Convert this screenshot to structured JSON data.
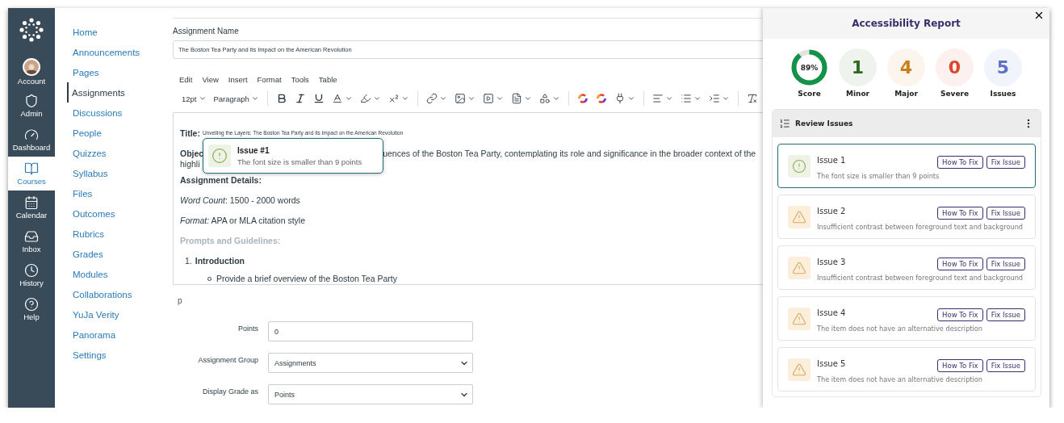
{
  "global_nav": [
    {
      "label": "Account",
      "selected": false
    },
    {
      "label": "Admin",
      "selected": false
    },
    {
      "label": "Dashboard",
      "selected": false
    },
    {
      "label": "Courses",
      "selected": true
    },
    {
      "label": "Calendar",
      "selected": false
    },
    {
      "label": "Inbox",
      "selected": false
    },
    {
      "label": "History",
      "selected": false
    },
    {
      "label": "Help",
      "selected": false
    }
  ],
  "course_nav": [
    {
      "label": "Home",
      "selected": false
    },
    {
      "label": "Announcements",
      "selected": false
    },
    {
      "label": "Pages",
      "selected": false
    },
    {
      "label": "Assignments",
      "selected": true
    },
    {
      "label": "Discussions",
      "selected": false
    },
    {
      "label": "People",
      "selected": false
    },
    {
      "label": "Quizzes",
      "selected": false
    },
    {
      "label": "Syllabus",
      "selected": false
    },
    {
      "label": "Files",
      "selected": false
    },
    {
      "label": "Outcomes",
      "selected": false
    },
    {
      "label": "Rubrics",
      "selected": false
    },
    {
      "label": "Grades",
      "selected": false
    },
    {
      "label": "Modules",
      "selected": false
    },
    {
      "label": "Collaborations",
      "selected": false
    },
    {
      "label": "YuJa Verity",
      "selected": false
    },
    {
      "label": "Panorama",
      "selected": false
    },
    {
      "label": "Settings",
      "selected": false
    }
  ],
  "assignment_name": {
    "label": "Assignment Name",
    "value": "The Boston Tea Party and its Impact on the American Revolution"
  },
  "editor": {
    "menu": [
      "Edit",
      "View",
      "Insert",
      "Format",
      "Tools",
      "Table"
    ],
    "font_size": "12pt",
    "block_format": "Paragraph",
    "title_label": "Title:",
    "title_text": "Unveiling the Layers: The Boston Tea Party and its Impact on the American Revolution",
    "objective_start": "Objec",
    "objective_rest": "uences of the Boston Tea Party, contemplating its role and significance in the broader context of the",
    "objective_line2": "highli",
    "details_heading": "Assignment Details:",
    "word_count": "*Word Count*: 1500 - 2000 words",
    "format": "*Format:* APA or MLA citation style",
    "prompts_heading": "Prompts and Guidelines:",
    "list_number": "1.",
    "list_item": "Introduction",
    "bullet": "Provide a brief overview of the Boston Tea Party",
    "path": "p"
  },
  "tooltip": {
    "title": "Issue #1",
    "message": "The font size is smaller than 9 points"
  },
  "fields": [
    {
      "label": "Points",
      "kind": "input",
      "value": "0"
    },
    {
      "label": "Assignment Group",
      "kind": "select",
      "value": "Assignments"
    },
    {
      "label": "Display Grade as",
      "kind": "select",
      "value": "Points"
    }
  ],
  "report": {
    "title": "Accessibility Report",
    "score": {
      "value": "89%",
      "label": "Score",
      "level": 0.89
    },
    "counts": [
      {
        "value": "1",
        "label": "Minor",
        "color": "#2f6b1e"
      },
      {
        "value": "4",
        "label": "Major",
        "color": "#c8821c"
      },
      {
        "value": "0",
        "label": "Severe",
        "color": "#d84a2b"
      },
      {
        "value": "5",
        "label": "Issues",
        "color": "#5a72c8"
      }
    ],
    "review_title": "Review Issues",
    "issues": [
      {
        "title": "Issue 1",
        "message": "The font size is smaller than 9 points",
        "kind": "minor",
        "selected": true,
        "actions": [
          "How To Fix",
          "Fix Issue"
        ]
      },
      {
        "title": "Issue 2",
        "message": "Insufficient contrast between foreground text and background",
        "kind": "major",
        "selected": false,
        "actions": [
          "How To Fix",
          "Fix Issue"
        ]
      },
      {
        "title": "Issue 3",
        "message": "Insufficient contrast between foreground text and background",
        "kind": "major",
        "selected": false,
        "actions": [
          "How To Fix",
          "Fix Issue"
        ]
      },
      {
        "title": "Issue 4",
        "message": "The item does not have an alternative description",
        "kind": "major",
        "selected": false,
        "actions": [
          "How To Fix",
          "Fix Issue"
        ]
      },
      {
        "title": "Issue 5",
        "message": "The item does not have an alternative description",
        "kind": "major",
        "selected": false,
        "actions": [
          "How To Fix",
          "Fix Issue"
        ]
      }
    ]
  }
}
